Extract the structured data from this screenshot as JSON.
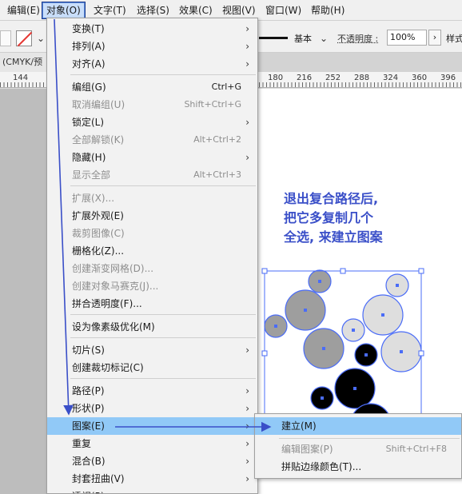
{
  "menubar": {
    "items": [
      {
        "label": "编辑(E)"
      },
      {
        "label": "对象(O)"
      },
      {
        "label": "文字(T)"
      },
      {
        "label": "选择(S)"
      },
      {
        "label": "效果(C)"
      },
      {
        "label": "视图(V)"
      },
      {
        "label": "窗口(W)"
      },
      {
        "label": "帮助(H)"
      }
    ],
    "active_index": 1
  },
  "control_bar": {
    "stroke_style_label": "基本",
    "opacity_label": "不透明度 :",
    "opacity_value": "100%",
    "opacity_arrow": "›",
    "style_label": "样式"
  },
  "document": {
    "tab_label": "(CMYK/预"
  },
  "ruler": {
    "numbers": [
      "144",
      "180",
      "216",
      "252",
      "288",
      "324",
      "360",
      "396"
    ]
  },
  "annotation": {
    "lines": [
      "退出复合路径后,",
      "把它多复制几个",
      "全选, 来建立图案"
    ],
    "color": "#3a4fc8"
  },
  "object_menu": {
    "items": [
      {
        "label": "变换(T)",
        "shortcut": "",
        "submenu": true,
        "disabled": false
      },
      {
        "label": "排列(A)",
        "shortcut": "",
        "submenu": true,
        "disabled": false
      },
      {
        "label": "对齐(A)",
        "shortcut": "",
        "submenu": true,
        "disabled": false
      },
      {
        "label": "编组(G)",
        "shortcut": "Ctrl+G",
        "submenu": false,
        "disabled": false
      },
      {
        "label": "取消编组(U)",
        "shortcut": "Shift+Ctrl+G",
        "submenu": false,
        "disabled": true
      },
      {
        "label": "锁定(L)",
        "shortcut": "",
        "submenu": true,
        "disabled": false
      },
      {
        "label": "全部解锁(K)",
        "shortcut": "Alt+Ctrl+2",
        "submenu": false,
        "disabled": true
      },
      {
        "label": "隐藏(H)",
        "shortcut": "",
        "submenu": true,
        "disabled": false
      },
      {
        "label": "显示全部",
        "shortcut": "Alt+Ctrl+3",
        "submenu": false,
        "disabled": true
      },
      {
        "label": "扩展(X)...",
        "shortcut": "",
        "submenu": false,
        "disabled": true
      },
      {
        "label": "扩展外观(E)",
        "shortcut": "",
        "submenu": false,
        "disabled": false
      },
      {
        "label": "裁剪图像(C)",
        "shortcut": "",
        "submenu": false,
        "disabled": true
      },
      {
        "label": "栅格化(Z)...",
        "shortcut": "",
        "submenu": false,
        "disabled": false
      },
      {
        "label": "创建渐变网格(D)...",
        "shortcut": "",
        "submenu": false,
        "disabled": true
      },
      {
        "label": "创建对象马赛克(J)...",
        "shortcut": "",
        "submenu": false,
        "disabled": true
      },
      {
        "label": "拼合透明度(F)...",
        "shortcut": "",
        "submenu": false,
        "disabled": false
      },
      {
        "label": "设为像素级优化(M)",
        "shortcut": "",
        "submenu": false,
        "disabled": false
      },
      {
        "label": "切片(S)",
        "shortcut": "",
        "submenu": true,
        "disabled": false
      },
      {
        "label": "创建裁切标记(C)",
        "shortcut": "",
        "submenu": false,
        "disabled": false
      },
      {
        "label": "路径(P)",
        "shortcut": "",
        "submenu": true,
        "disabled": false
      },
      {
        "label": "形状(P)",
        "shortcut": "",
        "submenu": true,
        "disabled": false
      },
      {
        "label": "图案(E)",
        "shortcut": "",
        "submenu": true,
        "disabled": false
      },
      {
        "label": "重复",
        "shortcut": "",
        "submenu": true,
        "disabled": false
      },
      {
        "label": "混合(B)",
        "shortcut": "",
        "submenu": true,
        "disabled": false
      },
      {
        "label": "封套扭曲(V)",
        "shortcut": "",
        "submenu": true,
        "disabled": false
      },
      {
        "label": "透视(P)",
        "shortcut": "",
        "submenu": true,
        "disabled": false
      }
    ],
    "highlighted_index": 21
  },
  "pattern_submenu": {
    "items": [
      {
        "label": "建立(M)",
        "shortcut": "",
        "disabled": false
      },
      {
        "label": "编辑图案(P)",
        "shortcut": "Shift+Ctrl+F8",
        "disabled": true
      },
      {
        "label": "拼贴边缘颜色(T)...",
        "shortcut": "",
        "disabled": false
      }
    ],
    "highlighted_index": 0
  },
  "colors": {
    "highlight": "#91c9f7",
    "arrow": "#3a4fc8",
    "selection": "#4a6cf7"
  }
}
